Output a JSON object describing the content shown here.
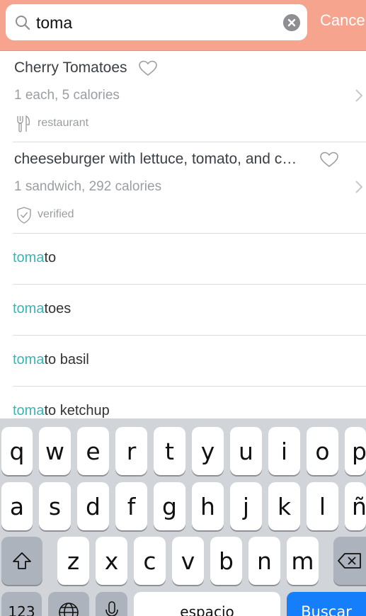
{
  "search": {
    "query": "toma",
    "cancel_label": "Cancel"
  },
  "food_results": [
    {
      "title": "Cherry Tomatoes",
      "serving": "1 each, 5 calories",
      "tag": "restaurant",
      "tag_icon": "fork-knife-icon"
    },
    {
      "title": "cheeseburger with lettuce, tomato, and c…",
      "serving": "1 sandwich, 292 calories",
      "tag": "verified",
      "tag_icon": "shield-check-icon"
    }
  ],
  "suggestions": [
    {
      "highlight": "toma",
      "rest": "to"
    },
    {
      "highlight": "toma",
      "rest": "toes"
    },
    {
      "highlight": "toma",
      "rest": "to basil"
    },
    {
      "highlight": "toma",
      "rest": "to ketchup"
    }
  ],
  "keyboard": {
    "row1": [
      "q",
      "w",
      "e",
      "r",
      "t",
      "y",
      "u",
      "i",
      "o",
      "p"
    ],
    "row2": [
      "a",
      "s",
      "d",
      "f",
      "g",
      "h",
      "j",
      "k",
      "l",
      "ñ"
    ],
    "row3": [
      "z",
      "x",
      "c",
      "v",
      "b",
      "n",
      "m"
    ],
    "numbers_label": "123",
    "space_label": "espacio",
    "return_label": "Buscar"
  },
  "colors": {
    "header_bg": "#f7a48f",
    "highlight": "#3cb5b5",
    "return_key": "#157efb"
  }
}
